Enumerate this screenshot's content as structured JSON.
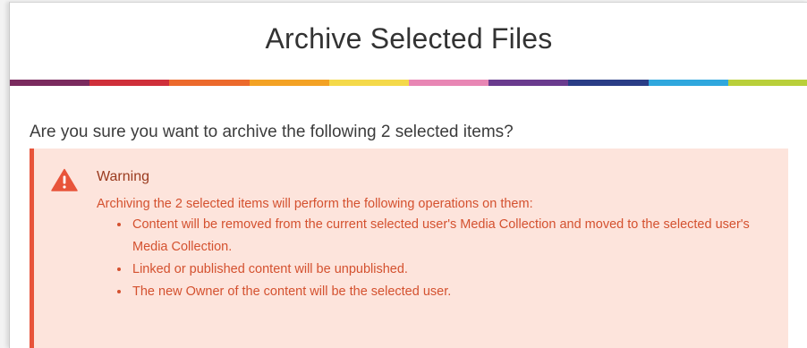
{
  "dialog": {
    "title": "Archive Selected Files",
    "color_band": [
      "#7a2a5e",
      "#cf2f3a",
      "#ec6a2c",
      "#f3a224",
      "#f4d94a",
      "#e886b4",
      "#6a3b8e",
      "#2a3d86",
      "#2fa7dd",
      "#b9cf3a"
    ]
  },
  "body": {
    "question": "Are you sure you want to archive the following 2 selected items?"
  },
  "warning": {
    "icon": "warning-triangle-icon",
    "title": "Warning",
    "intro": "Archiving the 2 selected items will perform the following operations on them:",
    "items": [
      "Content will be removed from the current selected user's Media Collection and moved to the selected user's Media Collection.",
      "Linked or published content will be unpublished.",
      "The new Owner of the content will be the selected user."
    ],
    "colors": {
      "background": "#fde4dc",
      "accent": "#e8543a",
      "text": "#d4512f"
    }
  }
}
